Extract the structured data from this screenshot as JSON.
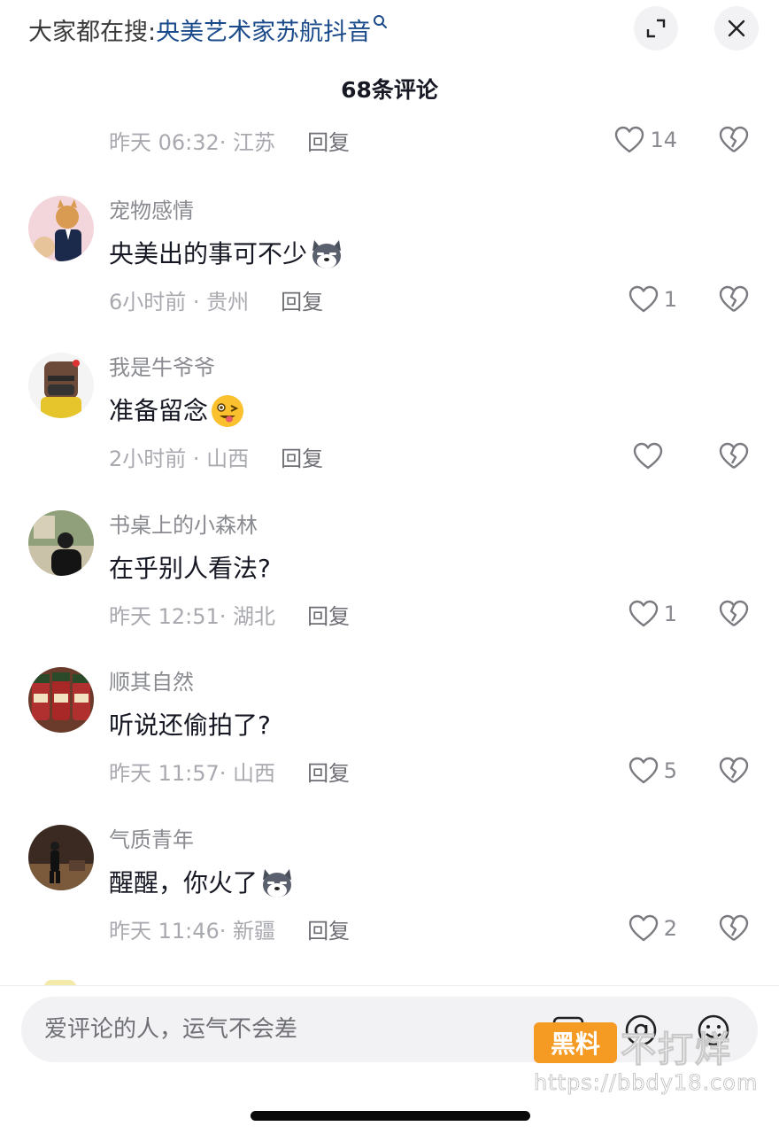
{
  "header": {
    "search_prefix": "大家都在搜:",
    "search_keyword": "央美艺术家苏航抖音",
    "comment_count": "68条评论"
  },
  "first_partial": {
    "meta": "昨天 06:32· 江苏",
    "reply": "回复",
    "likes": "14"
  },
  "comments": [
    {
      "username": "宠物感情",
      "text": "央美出的事可不少",
      "meta": "6小时前 · 贵州",
      "reply": "回复",
      "likes": "1"
    },
    {
      "username": "我是牛爷爷",
      "text": "准备留念",
      "meta": "2小时前 · 山西",
      "reply": "回复",
      "likes": ""
    },
    {
      "username": "书桌上的小森林",
      "text": "在乎别人看法?",
      "meta": "昨天 12:51· 湖北",
      "reply": "回复",
      "likes": "1"
    },
    {
      "username": "顺其自然",
      "text": "听说还偷拍了?",
      "meta": "昨天 11:57· 山西",
      "reply": "回复",
      "likes": "5"
    },
    {
      "username": "气质青年",
      "text": "醒醒，你火了",
      "meta": "昨天 11:46· 新疆",
      "reply": "回复",
      "likes": "2"
    }
  ],
  "input": {
    "placeholder": "爱评论的人，运气不会差"
  },
  "watermark": {
    "badge": "黑料",
    "text": "不打烊",
    "url": "https://bbdy18.com"
  },
  "icons": [
    "search-icon",
    "expand-icon",
    "close-icon",
    "heart-icon",
    "broken-heart-icon",
    "image-icon",
    "at-icon",
    "emoji-icon"
  ],
  "colors": {
    "keyword": "#1a4a8a",
    "watermark_badge": "#f59a23"
  }
}
